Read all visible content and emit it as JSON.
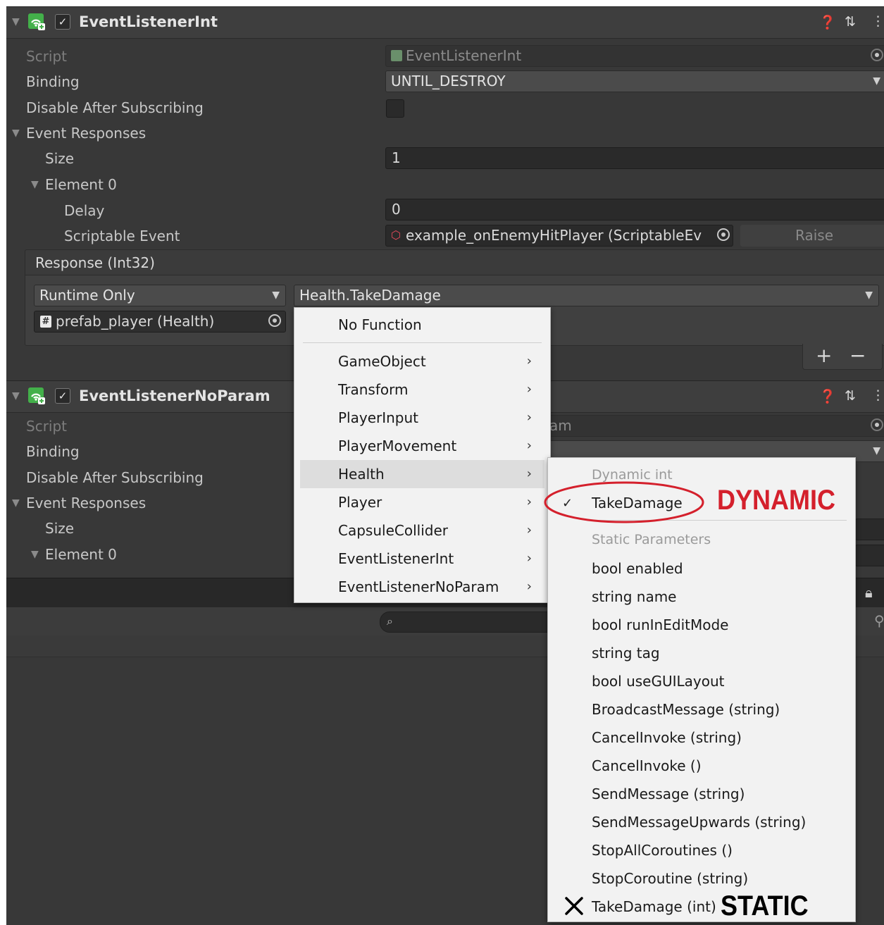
{
  "component1": {
    "title": "EventListenerInt",
    "enabled": true,
    "script_label": "Script",
    "script_value": "EventListenerInt",
    "binding_label": "Binding",
    "binding_value": "UNTIL_DESTROY",
    "disable_label": "Disable After Subscribing",
    "disable_checked": false,
    "responses_label": "Event Responses",
    "size_label": "Size",
    "size_value": "1",
    "element_label": "Element 0",
    "delay_label": "Delay",
    "delay_value": "0",
    "event_label": "Scriptable Event",
    "event_value": "example_onEnemyHitPlayer (ScriptableEv",
    "raise_label": "Raise",
    "response_title": "Response (Int32)",
    "runtime_value": "Runtime Only",
    "function_value": "Health.TakeDamage",
    "target_value": "prefab_player (Health)",
    "add_label": "+",
    "remove_label": "−"
  },
  "component2": {
    "title": "EventListenerNoParam",
    "enabled": true,
    "script_label": "Script",
    "script_value_partial": "am",
    "binding_label": "Binding",
    "disable_label": "Disable After Subscribing",
    "responses_label": "Event Responses",
    "size_label": "Size",
    "element_label": "Element 0"
  },
  "function_menu": {
    "no_function": "No Function",
    "items": [
      "GameObject",
      "Transform",
      "PlayerInput",
      "PlayerMovement",
      "Health",
      "Player",
      "CapsuleCollider",
      "EventListenerInt",
      "EventListenerNoParam"
    ],
    "highlighted": "Health"
  },
  "health_submenu": {
    "dynamic_header": "Dynamic int",
    "dynamic_item": "TakeDamage",
    "static_header": "Static Parameters",
    "static_items": [
      "bool enabled",
      "string name",
      "bool runInEditMode",
      "string tag",
      "bool useGUILayout",
      "BroadcastMessage (string)",
      "CancelInvoke (string)",
      "CancelInvoke ()",
      "SendMessage (string)",
      "SendMessageUpwards (string)",
      "StopAllCoroutines ()",
      "StopCoroutine (string)",
      "TakeDamage (int)"
    ]
  },
  "annotations": {
    "dynamic": "DYNAMIC",
    "static": "STATIC",
    "dynamic_color": "#d4202c",
    "static_color": "#000000"
  },
  "colors": {
    "inspector_bg": "#383838",
    "menu_bg": "#f2f2f2",
    "icon_green": "#43b04a"
  }
}
